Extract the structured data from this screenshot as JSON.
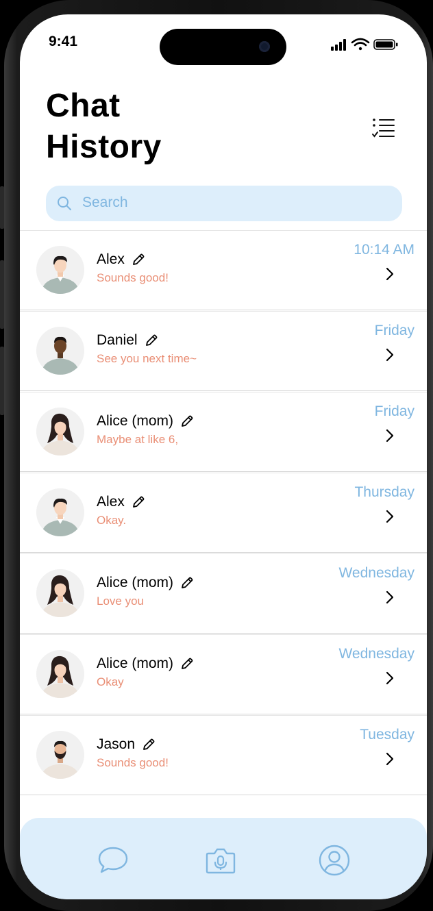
{
  "status_bar": {
    "time": "9:41"
  },
  "header": {
    "title_line1": "Chat",
    "title_line2": "History"
  },
  "search": {
    "placeholder": "Search"
  },
  "chats": [
    {
      "name": "Alex",
      "preview": "Sounds good!",
      "time": "10:14 AM",
      "avatar": "man-light"
    },
    {
      "name": "Daniel",
      "preview": "See you next time~",
      "time": "Friday",
      "avatar": "man-dark"
    },
    {
      "name": "Alice (mom)",
      "preview": "Maybe at like 6,",
      "time": "Friday",
      "avatar": "woman"
    },
    {
      "name": "Alex",
      "preview": "Okay.",
      "time": "Thursday",
      "avatar": "man-light"
    },
    {
      "name": "Alice (mom)",
      "preview": "Love you",
      "time": "Wednesday",
      "avatar": "woman"
    },
    {
      "name": "Alice (mom)",
      "preview": "Okay",
      "time": "Wednesday",
      "avatar": "woman"
    },
    {
      "name": "Jason",
      "preview": "Sounds good!",
      "time": "Tuesday",
      "avatar": "man-beard"
    }
  ],
  "tabbar": {
    "icons": [
      "chat-bubble-icon",
      "mic-camera-icon",
      "profile-icon"
    ]
  },
  "colors": {
    "accent_blue": "#7fb6e0",
    "search_bg": "#ddeefb",
    "preview_text": "#e98e75"
  }
}
